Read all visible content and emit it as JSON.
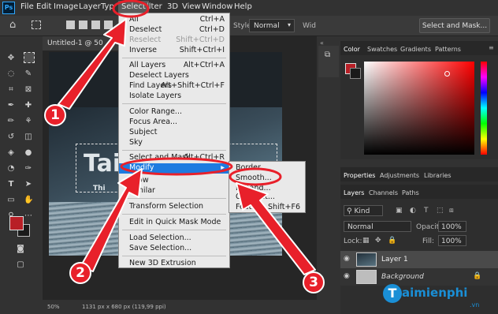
{
  "app_logo": "Ps",
  "menubar": [
    "File",
    "Edit",
    "Image",
    "Layer",
    "Typ",
    "Select",
    "ilter",
    "3D",
    "View",
    "Window",
    "Help"
  ],
  "options": {
    "style_label": "Style:",
    "style_value": "Normal",
    "wid_label": "Wid",
    "select_mask_button": "Select and Mask..."
  },
  "document": {
    "tab": "Untitled-1 @ 50",
    "overlay_title": "Tai",
    "overlay_sub": "Thi"
  },
  "status": {
    "zoom": "50%",
    "info": "1131 px x 680 px (119,99 ppi)"
  },
  "select_menu": {
    "items": [
      {
        "label": "All",
        "shortcut": "Ctrl+A"
      },
      {
        "label": "Deselect",
        "shortcut": "Ctrl+D"
      },
      {
        "label": "Reselect",
        "shortcut": "Shift+Ctrl+D"
      },
      {
        "label": "Inverse",
        "shortcut": "Shift+Ctrl+I"
      },
      {
        "label": "All Layers",
        "shortcut": "Alt+Ctrl+A"
      },
      {
        "label": "Deselect Layers",
        "shortcut": ""
      },
      {
        "label": "Find Layers",
        "shortcut": "Alt+Shift+Ctrl+F"
      },
      {
        "label": "Isolate Layers",
        "shortcut": ""
      },
      {
        "label": "Color Range...",
        "shortcut": ""
      },
      {
        "label": "Focus Area...",
        "shortcut": ""
      },
      {
        "label": "Subject",
        "shortcut": ""
      },
      {
        "label": "Sky",
        "shortcut": ""
      },
      {
        "label": "Select and Mask...",
        "shortcut": "Alt+Ctrl+R"
      },
      {
        "label": "Modify",
        "shortcut": ""
      },
      {
        "label": "Grow",
        "shortcut": ""
      },
      {
        "label": "Similar",
        "shortcut": ""
      },
      {
        "label": "Transform Selection",
        "shortcut": ""
      },
      {
        "label": "Edit in Quick Mask Mode",
        "shortcut": ""
      },
      {
        "label": "Load Selection...",
        "shortcut": ""
      },
      {
        "label": "Save Selection...",
        "shortcut": ""
      },
      {
        "label": "New 3D Extrusion",
        "shortcut": ""
      }
    ]
  },
  "modify_submenu": {
    "items": [
      {
        "label": "Border...",
        "shortcut": ""
      },
      {
        "label": "Smooth...",
        "shortcut": ""
      },
      {
        "label": "Expand...",
        "shortcut": ""
      },
      {
        "label": "Contract...",
        "shortcut": ""
      },
      {
        "label": "Feather...",
        "shortcut": "Shift+F6"
      }
    ]
  },
  "color_panel": {
    "tabs": [
      "Color",
      "Swatches",
      "Gradients",
      "Patterns"
    ],
    "foreground": "#b81f26",
    "hue": "#ff0000"
  },
  "props_tabs": [
    "Properties",
    "Adjustments",
    "Libraries"
  ],
  "layers_panel": {
    "tabs": [
      "Layers",
      "Channels",
      "Paths"
    ],
    "filter": "Kind",
    "blend": "Normal",
    "opacity_label": "Opacity:",
    "opacity": "100%",
    "lock_label": "Lock:",
    "fill_label": "Fill:",
    "fill": "100%",
    "layers": [
      {
        "name": "Layer 1"
      },
      {
        "name": "Background"
      }
    ]
  },
  "callouts": [
    "1",
    "2",
    "3"
  ],
  "watermark": {
    "brand": "aimienphi",
    "sub": ".vn"
  }
}
